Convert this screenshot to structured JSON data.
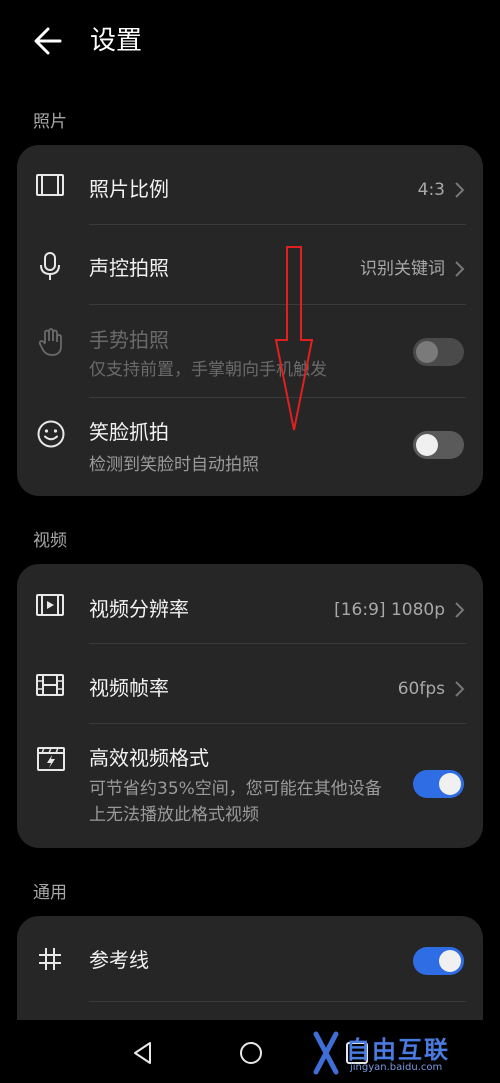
{
  "header": {
    "title": "设置"
  },
  "sections": {
    "photo": {
      "label": "照片"
    },
    "video": {
      "label": "视频"
    },
    "general": {
      "label": "通用"
    }
  },
  "photo_rows": {
    "ratio": {
      "title": "照片比例",
      "value": "4:3",
      "icon": "aspect-ratio-icon"
    },
    "voice": {
      "title": "声控拍照",
      "value": "识别关键词",
      "icon": "microphone-icon"
    },
    "gesture": {
      "title": "手势拍照",
      "subtitle": "仅支持前置，手掌朝向手机触发",
      "icon": "hand-icon",
      "toggle": "off",
      "enabled": false
    },
    "smile": {
      "title": "笑脸抓拍",
      "subtitle": "检测到笑脸时自动拍照",
      "icon": "smiley-icon",
      "toggle": "off"
    }
  },
  "video_rows": {
    "resolution": {
      "title": "视频分辨率",
      "value": "[16:9] 1080p",
      "icon": "video-resolution-icon"
    },
    "framerate": {
      "title": "视频帧率",
      "value": "60fps",
      "icon": "film-icon"
    },
    "format": {
      "title": "高效视频格式",
      "subtitle": "可节省约35%空间，您可能在其他设备上无法播放此格式视频",
      "icon": "video-format-icon",
      "toggle": "on"
    }
  },
  "general_rows": {
    "grid": {
      "title": "参考线",
      "icon": "grid-icon",
      "toggle": "on"
    }
  },
  "watermark": {
    "text": "自由互联",
    "sub": "jingyan.baidu.com"
  },
  "colors": {
    "background": "#000000",
    "card": "#262626",
    "accent": "#2f6de5",
    "annotation": "#e02020"
  }
}
